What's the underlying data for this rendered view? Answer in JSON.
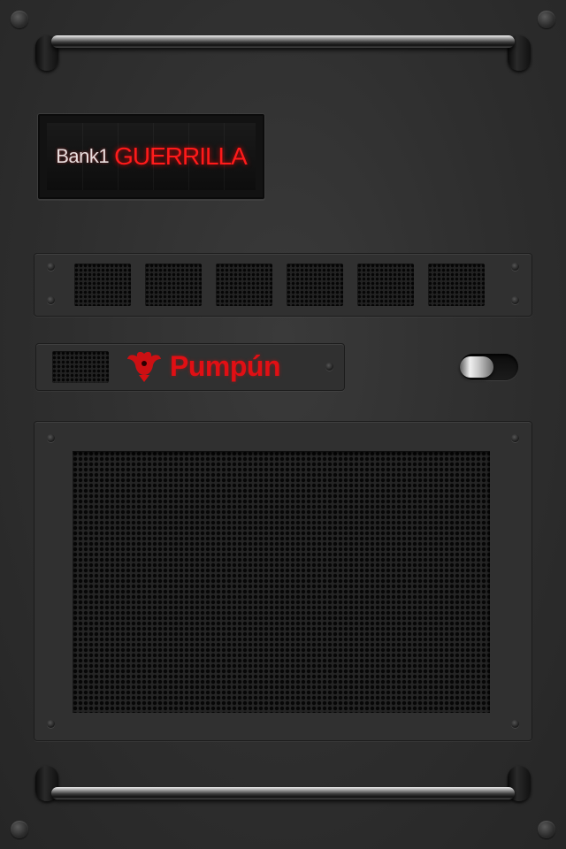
{
  "display": {
    "bank_label": "Bank1",
    "preset_name": "GUERRILLA"
  },
  "brand": {
    "name": "Pumpún",
    "logo_icon": "phoenix-icon"
  },
  "power_toggle": {
    "state": "off"
  },
  "colors": {
    "accent_red": "#e10f14",
    "panel": "#303030",
    "background": "#2e2e2e"
  }
}
